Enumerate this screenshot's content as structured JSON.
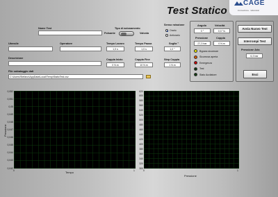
{
  "header": {
    "title": "Test Statico",
    "logo_text": "CAGE",
    "logo_subtitle": "innovazione · laboratori"
  },
  "form": {
    "nome_test_label": "Nome Test",
    "nome_test_value": "",
    "tipo_label": "Tipo di azionamento",
    "tipo_left": "Polsante",
    "tipo_right": "Valvola",
    "senso_label": "Senso rotazione",
    "senso_opt1": "Orario",
    "senso_opt2": "Antiorario",
    "cliente_label": "Utensile",
    "cliente_value": "",
    "operatore_label": "Operatore",
    "operatore_value": "",
    "tempo_lavoro_label": "Tempo Lavoro",
    "tempo_lavoro_value": "1,0 s",
    "tempo_pausa_label": "Tempo Pausa",
    "tempo_pausa_value": "1,0 s",
    "soglia_label": "Soglia °",
    "soglia_value": "1,0 °",
    "descrizione_label": "Descrizione",
    "descrizione_value": "",
    "coppia_inizio_label": "Coppia Inizio",
    "coppia_inizio_value": "0 N.m",
    "coppia_fine_label": "Coppia Fine",
    "coppia_fine_value": "10 N.m",
    "step_label": "Step Coppia",
    "step_value": "1 N.m",
    "file_label": "File salvataggio dati",
    "file_value": "C:\\Users\\Stefano\\AppData\\Local\\Temp\\StaticTest.csv"
  },
  "readouts": {
    "angolo_label": "Angolo",
    "angolo_value": "0 °",
    "velocita_label": "Velocità",
    "velocita_value": "0,0 °/s",
    "pressione_label": "Pressione",
    "pressione_value": "27,3 bar",
    "coppia_label": "Coppia",
    "coppia_value": "0 N.m",
    "pressione_aria_label": "Pressione Aria",
    "pressione_aria_value": "6,3 bar"
  },
  "status": [
    {
      "label": "Bypass sicurezze",
      "color": "#e6e600"
    },
    {
      "label": "Sicurezza aperta",
      "color": "#e05a00"
    },
    {
      "label": "Emergenza",
      "color": "#cc0000"
    },
    {
      "label": "Test",
      "color": "#103a10"
    },
    {
      "label": "Stato Accitatore",
      "color": "#103a10"
    }
  ],
  "buttons": {
    "avvia": "Avvia Nuovo Test",
    "interrompi": "Interrompi Test",
    "esci": "Esci"
  },
  "chart_left": {
    "ylabel": "Pressione",
    "xlabel": "Tempo",
    "yticks": [
      "0,052",
      "0,051",
      "0,05",
      "0,049",
      "0,048",
      "0,047",
      "0,046",
      "0,045",
      "0,044",
      "0,043",
      "0,042"
    ],
    "xticks": [
      "0",
      "1"
    ]
  },
  "chart_right": {
    "ylabel": "Angolo",
    "xlabel": "Pressione",
    "yticks": [
      "620",
      "600",
      "580",
      "560",
      "540",
      "520",
      "500",
      "480",
      "460",
      "440",
      "420",
      "400",
      "380",
      "360",
      "340",
      "320",
      "300"
    ],
    "xticks": [
      "0",
      "1"
    ]
  }
}
